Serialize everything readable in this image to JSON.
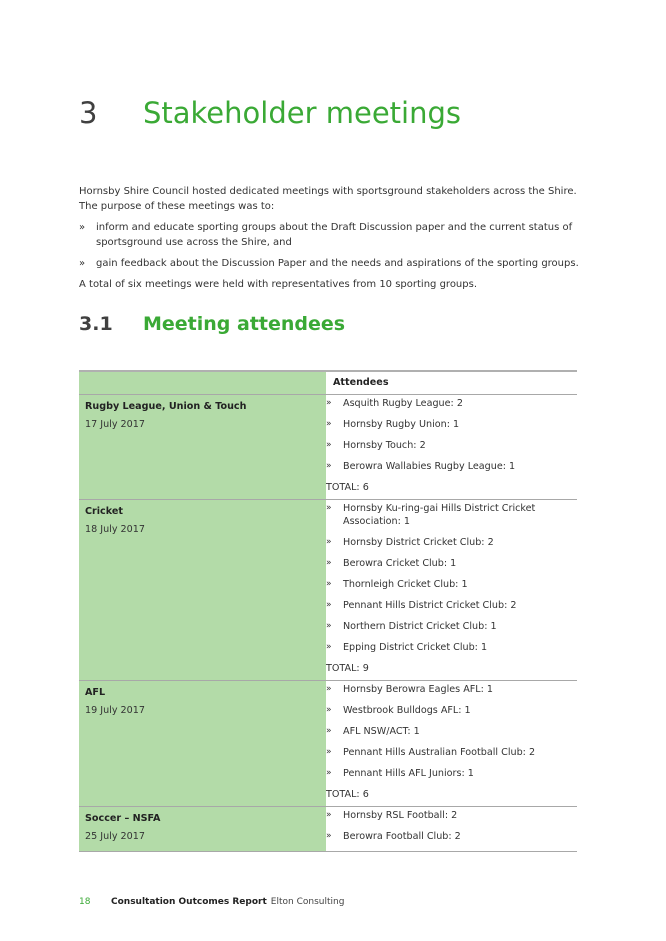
{
  "heading": {
    "number": "3",
    "title": "Stakeholder meetings"
  },
  "intro": {
    "paragraph1": "Hornsby Shire Council hosted dedicated meetings with sportsground stakeholders across the Shire. The purpose of these meetings was to:",
    "bullets": [
      "inform and educate sporting groups about the Draft Discussion paper and the current status of sportsground use across the Shire, and",
      "gain feedback about the Discussion Paper and the needs and aspirations of the sporting groups."
    ],
    "paragraph2": "A total of six meetings were held with representatives from 10 sporting groups.",
    "bullet_glyph": "»"
  },
  "subheading": {
    "number": "3.1",
    "title": "Meeting attendees"
  },
  "table": {
    "header_right": "Attendees",
    "colors": {
      "group_bg": "#b3dba8",
      "accent": "#3aa935"
    },
    "groups": [
      {
        "name": "Rugby League, Union & Touch",
        "date": "17 July 2017",
        "attendees": [
          "Asquith Rugby League: 2",
          "Hornsby Rugby Union: 1",
          "Hornsby Touch: 2",
          "Berowra Wallabies Rugby League: 1"
        ],
        "total": "TOTAL: 6"
      },
      {
        "name": "Cricket",
        "date": "18 July 2017",
        "attendees": [
          "Hornsby Ku-ring-gai Hills District Cricket Association: 1",
          "Hornsby District Cricket Club: 2",
          "Berowra Cricket Club: 1",
          "Thornleigh Cricket Club: 1",
          "Pennant Hills District Cricket Club: 2",
          "Northern District Cricket Club: 1",
          "Epping District Cricket Club: 1"
        ],
        "total": "TOTAL: 9"
      },
      {
        "name": "AFL",
        "date": "19 July 2017",
        "attendees": [
          "Hornsby Berowra Eagles AFL: 1",
          "Westbrook Bulldogs AFL: 1",
          "AFL NSW/ACT: 1",
          "Pennant Hills Australian Football Club: 2",
          "Pennant Hills AFL Juniors: 1"
        ],
        "total": "TOTAL: 6"
      },
      {
        "name": "Soccer – NSFA",
        "date": "25 July 2017",
        "attendees": [
          "Hornsby RSL Football: 2",
          "Berowra Football Club: 2"
        ],
        "total": null
      }
    ]
  },
  "footer": {
    "page": "18",
    "report": "Consultation Outcomes Report",
    "org": "Elton Consulting"
  }
}
